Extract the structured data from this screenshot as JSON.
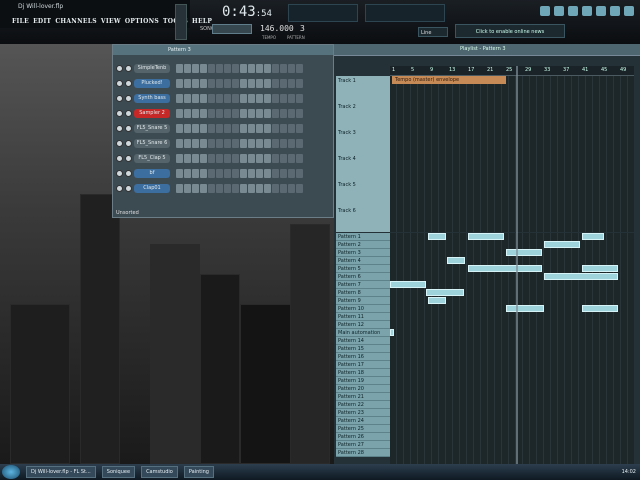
{
  "window": {
    "title": "Dj Will-lover.flp"
  },
  "menu": [
    "FILE",
    "EDIT",
    "CHANNELS",
    "VIEW",
    "OPTIONS",
    "TOOLS",
    "HELP"
  ],
  "transport": {
    "time": "0:43",
    "time_frac": ":54",
    "tempo": "146.000",
    "tempo_label": "TEMPO",
    "pattern": "3",
    "pattern_label": "PATTERN",
    "mode": "SONG"
  },
  "news": "Click to enable online news",
  "line_label": "Line",
  "stepseq": {
    "pattern_label": "Pattern 3",
    "channels": [
      {
        "name": "SimpleTenb",
        "color": "grey"
      },
      {
        "name": "Plucked!",
        "color": "blue"
      },
      {
        "name": "Synth bass",
        "color": "blue"
      },
      {
        "name": "Sampler 2",
        "color": "red"
      },
      {
        "name": "FL5_Snare 5",
        "color": "grey"
      },
      {
        "name": "FL5_Snare 6",
        "color": "grey"
      },
      {
        "name": "FL5_Clap 5",
        "color": "grey"
      },
      {
        "name": "bf",
        "color": "blue"
      },
      {
        "name": "Clap01",
        "color": "blue"
      }
    ],
    "filter": "Unsorted"
  },
  "playlist": {
    "title": "Playlist - Pattern 3",
    "ruler": [
      "1",
      "5",
      "9",
      "13",
      "17",
      "21",
      "25",
      "29",
      "33",
      "37",
      "41",
      "45",
      "49"
    ],
    "tracks": [
      "Track 1",
      "Track 2",
      "Track 3",
      "Track 4",
      "Track 5",
      "Track 6"
    ],
    "tempo_clip": "Tempo (master) envelope",
    "patterns": [
      "Pattern 1",
      "Pattern 2",
      "Pattern 3",
      "Pattern 4",
      "Pattern 5",
      "Pattern 6",
      "Pattern 7",
      "Pattern 8",
      "Pattern 9",
      "Pattern 10",
      "Pattern 11",
      "Pattern 12",
      "Main automation",
      "Pattern 14",
      "Pattern 15",
      "Pattern 16",
      "Pattern 17",
      "Pattern 18",
      "Pattern 19",
      "Pattern 20",
      "Pattern 21",
      "Pattern 22",
      "Pattern 23",
      "Pattern 24",
      "Pattern 25",
      "Pattern 26",
      "Pattern 27",
      "Pattern 28"
    ]
  },
  "taskbar": {
    "items": [
      "Dj Will-lover.flp - FL St...",
      "Soniquee",
      "Camstudio",
      "Painting"
    ],
    "clock": "14:02"
  },
  "colors": {
    "accent": "#9fd3dc",
    "tempo_clip": "#c58a56",
    "red_channel": "#c62828"
  }
}
